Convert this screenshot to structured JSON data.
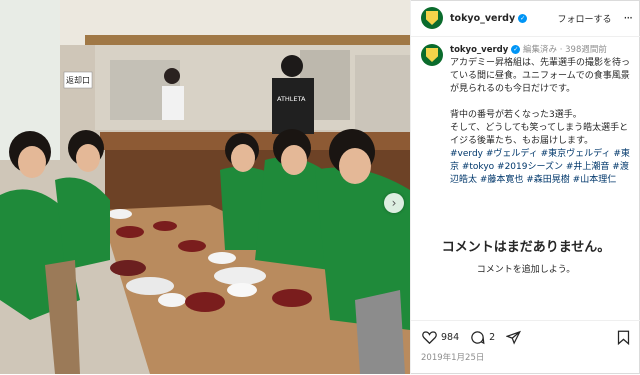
{
  "header": {
    "username": "tokyo_verdy",
    "follow_label": "フォローする",
    "more_label": "···"
  },
  "caption": {
    "username": "tokyo_verdy",
    "edited": "編集済み",
    "time_ago": "398週間前",
    "text": "アカデミー昇格組は、先輩選手の撮影を待っている間に昼食。ユニフォームでの食事風景が見られるのも今日だけです。\n\n背中の番号が若くなった3選手。\nそして、どうしても笑ってしまう皓太選手とイジる後輩たち、もお届けします。",
    "hashtags": "#verdy #ヴェルディ #東京ヴェルディ #東京 #tokyo #2019シーズン #井上潮音 #渡辺皓太 #藤本寛也 #森田晃樹 #山本理仁"
  },
  "comments": {
    "empty_title": "コメントはまだありません。",
    "add_prompt": "コメントを追加しよう。"
  },
  "actions": {
    "likes": "984",
    "comments": "2"
  },
  "date": "2019年1月25日",
  "photo": {
    "sign_text": "返却口",
    "jersey_text": "ATHLETA"
  },
  "colors": {
    "verified": "#0095f6",
    "jersey": "#1f8a3a",
    "hashtag": "#00376b"
  }
}
